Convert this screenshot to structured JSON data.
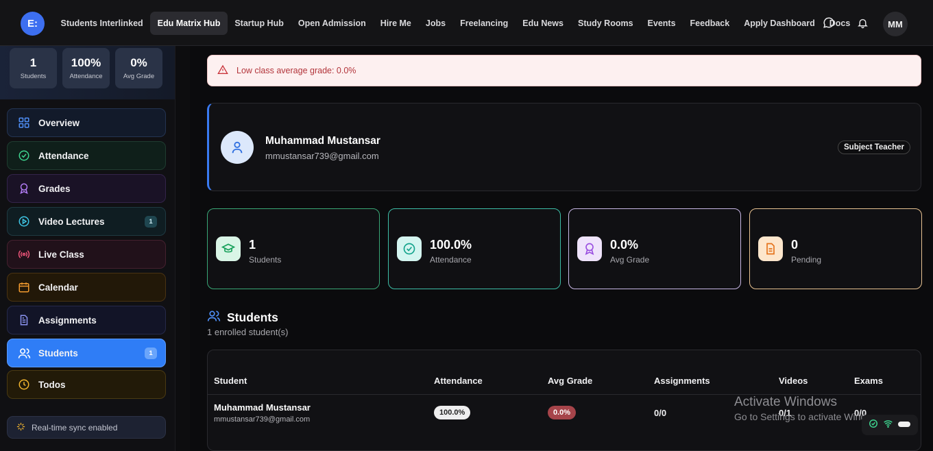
{
  "header": {
    "logo_text": "E:",
    "nav": [
      "Students Interlinked",
      "Edu Matrix Hub",
      "Startup Hub",
      "Open Admission",
      "Hire Me",
      "Jobs",
      "Freelancing",
      "Edu News",
      "Study Rooms",
      "Events",
      "Feedback",
      "Apply Dashboard",
      "Docs"
    ],
    "active_nav": "Edu Matrix Hub",
    "avatar_initials": "MM"
  },
  "sidebar": {
    "stats": [
      {
        "value": "1",
        "label": "Students"
      },
      {
        "value": "100%",
        "label": "Attendance"
      },
      {
        "value": "0%",
        "label": "Avg Grade"
      }
    ],
    "items": [
      {
        "label": "Overview",
        "icon": "grid-icon"
      },
      {
        "label": "Attendance",
        "icon": "check-circle-icon"
      },
      {
        "label": "Grades",
        "icon": "award-icon"
      },
      {
        "label": "Video Lectures",
        "icon": "play-circle-icon",
        "badge": "1"
      },
      {
        "label": "Live Class",
        "icon": "broadcast-icon"
      },
      {
        "label": "Calendar",
        "icon": "calendar-icon"
      },
      {
        "label": "Assignments",
        "icon": "document-icon"
      },
      {
        "label": "Students",
        "icon": "users-icon",
        "badge": "1"
      },
      {
        "label": "Todos",
        "icon": "clock-icon"
      }
    ],
    "active_item": "Students",
    "sync_label": "Real-time sync enabled"
  },
  "alert": {
    "text": "Low class average grade: 0.0%"
  },
  "profile": {
    "name": "Muhammad Mustansar",
    "email": "mmustansar739@gmail.com",
    "role": "Subject Teacher"
  },
  "cards": [
    {
      "value": "1",
      "label": "Students"
    },
    {
      "value": "100.0%",
      "label": "Attendance"
    },
    {
      "value": "0.0%",
      "label": "Avg Grade"
    },
    {
      "value": "0",
      "label": "Pending"
    }
  ],
  "students_section": {
    "title": "Students",
    "subtitle": "1 enrolled student(s)",
    "columns": [
      "Student",
      "Attendance",
      "Avg Grade",
      "Assignments",
      "Videos",
      "Exams"
    ],
    "rows": [
      {
        "name": "Muhammad Mustansar",
        "email": "mmustansar739@gmail.com",
        "attendance": "100.0%",
        "avg_grade": "0.0%",
        "assignments": "0/0",
        "videos": "0/1",
        "exams": "0/0"
      }
    ]
  },
  "os_overlay": {
    "line1": "Activate Windows",
    "line2": "Go to Settings to activate Windows."
  },
  "colors": {
    "accent": "#3a7bf2",
    "alert_text": "#b2343a",
    "alert_bg": "#fdf0f0"
  }
}
